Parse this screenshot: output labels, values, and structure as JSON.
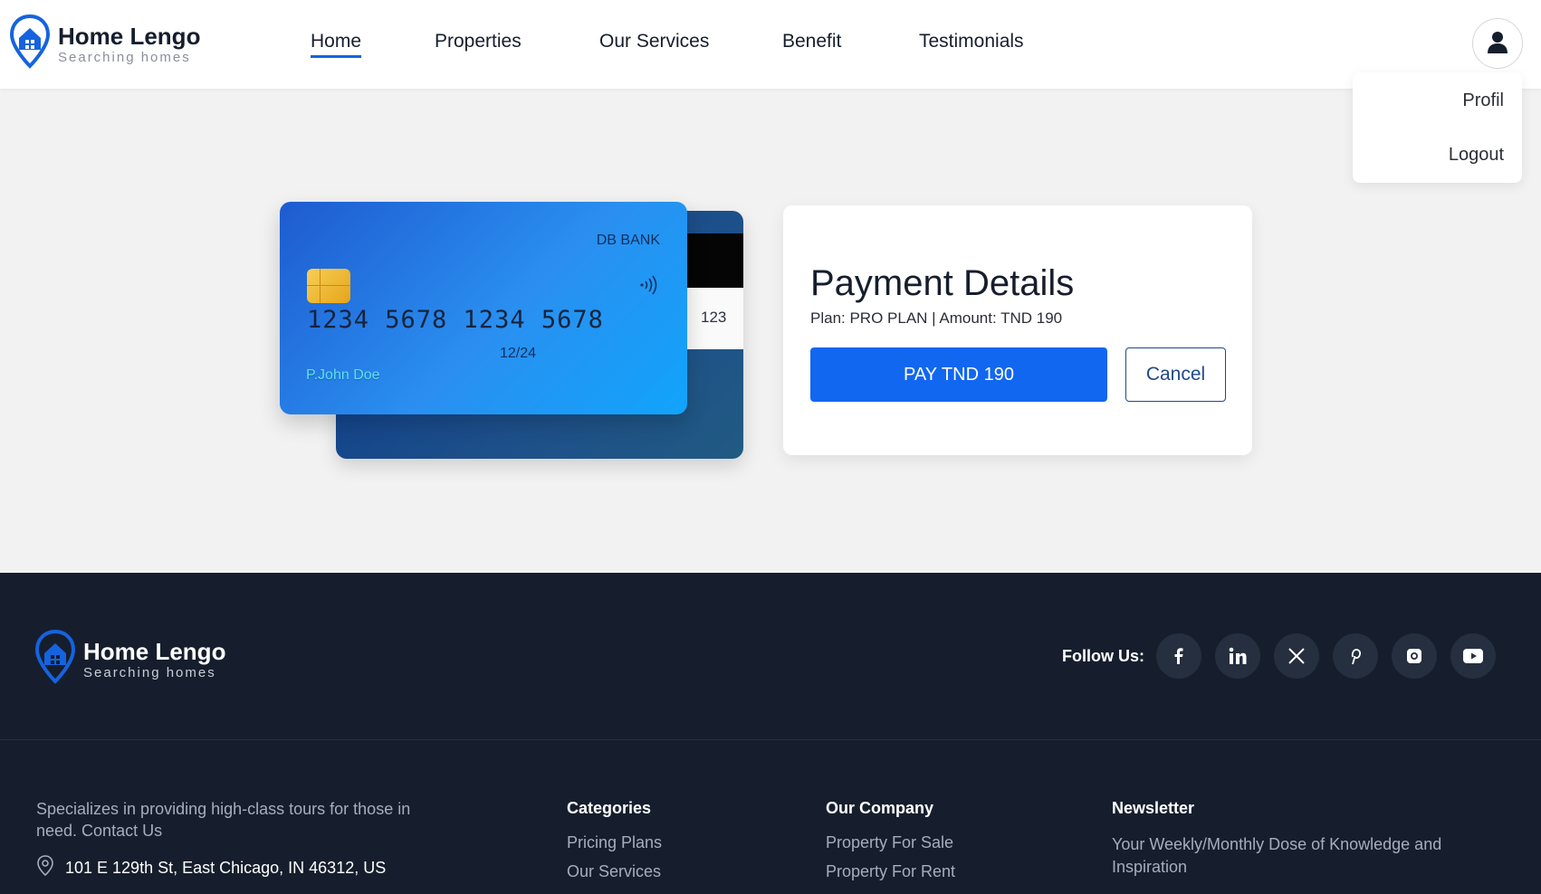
{
  "brand": {
    "name": "Home Lengo",
    "tagline": "Searching homes"
  },
  "nav": {
    "items": [
      "Home",
      "Properties",
      "Our Services",
      "Benefit",
      "Testimonials"
    ],
    "active": "Home"
  },
  "user_menu": {
    "items": [
      "Profil",
      "Logout"
    ]
  },
  "card": {
    "bank": "DB BANK",
    "number": "1234 5678 1234 5678",
    "expiry": "12/24",
    "holder": "P.John Doe",
    "cvv": "123"
  },
  "payment": {
    "title": "Payment Details",
    "plan_line": "Plan: PRO PLAN | Amount: TND 190",
    "pay_label": "PAY TND 190",
    "cancel_label": "Cancel"
  },
  "footer": {
    "follow_label": "Follow Us:",
    "social": [
      "facebook-icon",
      "linkedin-icon",
      "x-icon",
      "pinterest-icon",
      "instagram-icon",
      "youtube-icon"
    ],
    "description": "Specializes in providing high-class tours for those in need. Contact Us",
    "address": "101 E 129th St, East Chicago, IN 46312, US",
    "categories": {
      "title": "Categories",
      "links": [
        "Pricing Plans",
        "Our Services"
      ]
    },
    "company": {
      "title": "Our Company",
      "links": [
        "Property For Sale",
        "Property For Rent"
      ]
    },
    "newsletter": {
      "title": "Newsletter",
      "text": "Your Weekly/Monthly Dose of Knowledge and Inspiration"
    }
  },
  "colors": {
    "accent": "#1167f0",
    "dark": "#161e2d",
    "card_gradient_start": "#1e5bd0",
    "card_gradient_end": "#11a4fb"
  }
}
